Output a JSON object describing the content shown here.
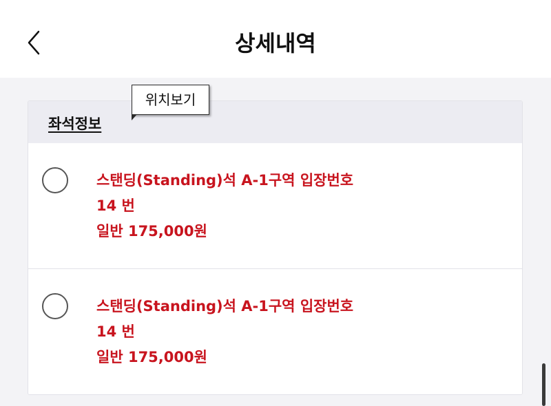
{
  "header": {
    "back_icon": "chevron-left-icon",
    "title": "상세내역"
  },
  "tooltip": {
    "label": "위치보기"
  },
  "seat_section": {
    "title": "좌석정보",
    "items": [
      {
        "name": "스탠딩(Standing)석 A-1구역 입장번호14 번",
        "price": "일반 175,000원"
      },
      {
        "name": "스탠딩(Standing)석 A-1구역 입장번호14 번",
        "price": "일반 175,000원"
      }
    ]
  },
  "colors": {
    "accent_red": "#c8141e",
    "background": "#f3f3f6",
    "section_header": "#ececf2"
  }
}
